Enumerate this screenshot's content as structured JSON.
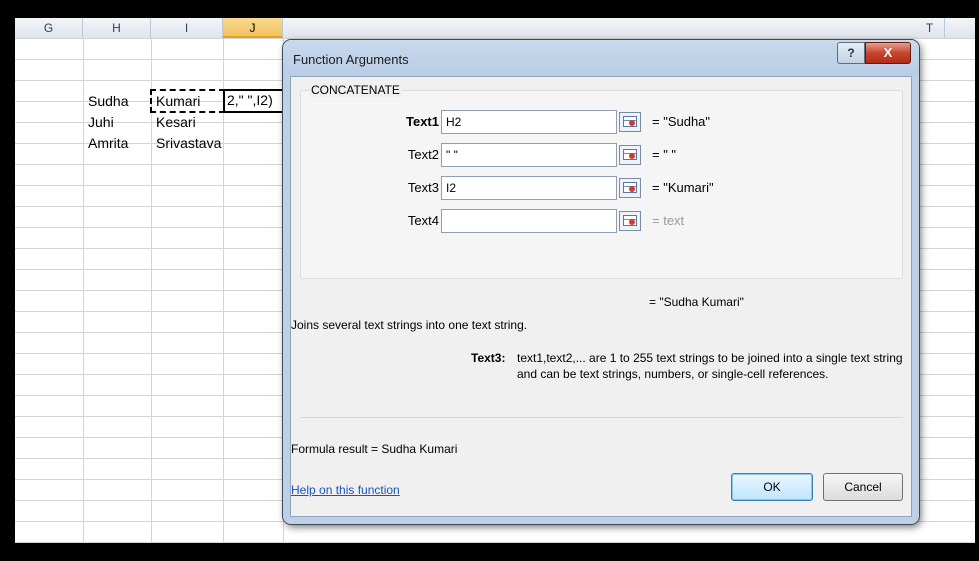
{
  "sheet": {
    "columns": [
      "G",
      "H",
      "I",
      "J",
      "T"
    ],
    "active_column": "J",
    "rows": [
      {
        "h": "Sudha",
        "i": "Kumari"
      },
      {
        "h": "Juhi",
        "i": "Kesari"
      },
      {
        "h": "Amrita",
        "i": "Srivastava"
      }
    ],
    "active_cell_text": "2,\" \",I2)"
  },
  "dialog": {
    "title": "Function Arguments",
    "help_glyph": "?",
    "close_glyph": "X",
    "function_name": "CONCATENATE",
    "args": [
      {
        "label": "Text1",
        "value": "H2",
        "result": "= \"Sudha\""
      },
      {
        "label": "Text2",
        "value": "\" \"",
        "result": "= \" \""
      },
      {
        "label": "Text3",
        "value": "I2",
        "result": "= \"Kumari\""
      },
      {
        "label": "Text4",
        "value": "",
        "result": "= text"
      }
    ],
    "overall_result": "= \"Sudha Kumari\"",
    "description": "Joins several text strings into one text string.",
    "arg_help_name": "Text3:",
    "arg_help_line1": "text1,text2,... are 1 to 255 text strings to be joined into a single text string",
    "arg_help_line2": "and can be text strings, numbers, or single-cell references.",
    "formula_result": "Formula result =   Sudha Kumari",
    "help_link": "Help on this function",
    "ok_label": "OK",
    "cancel_label": "Cancel"
  }
}
